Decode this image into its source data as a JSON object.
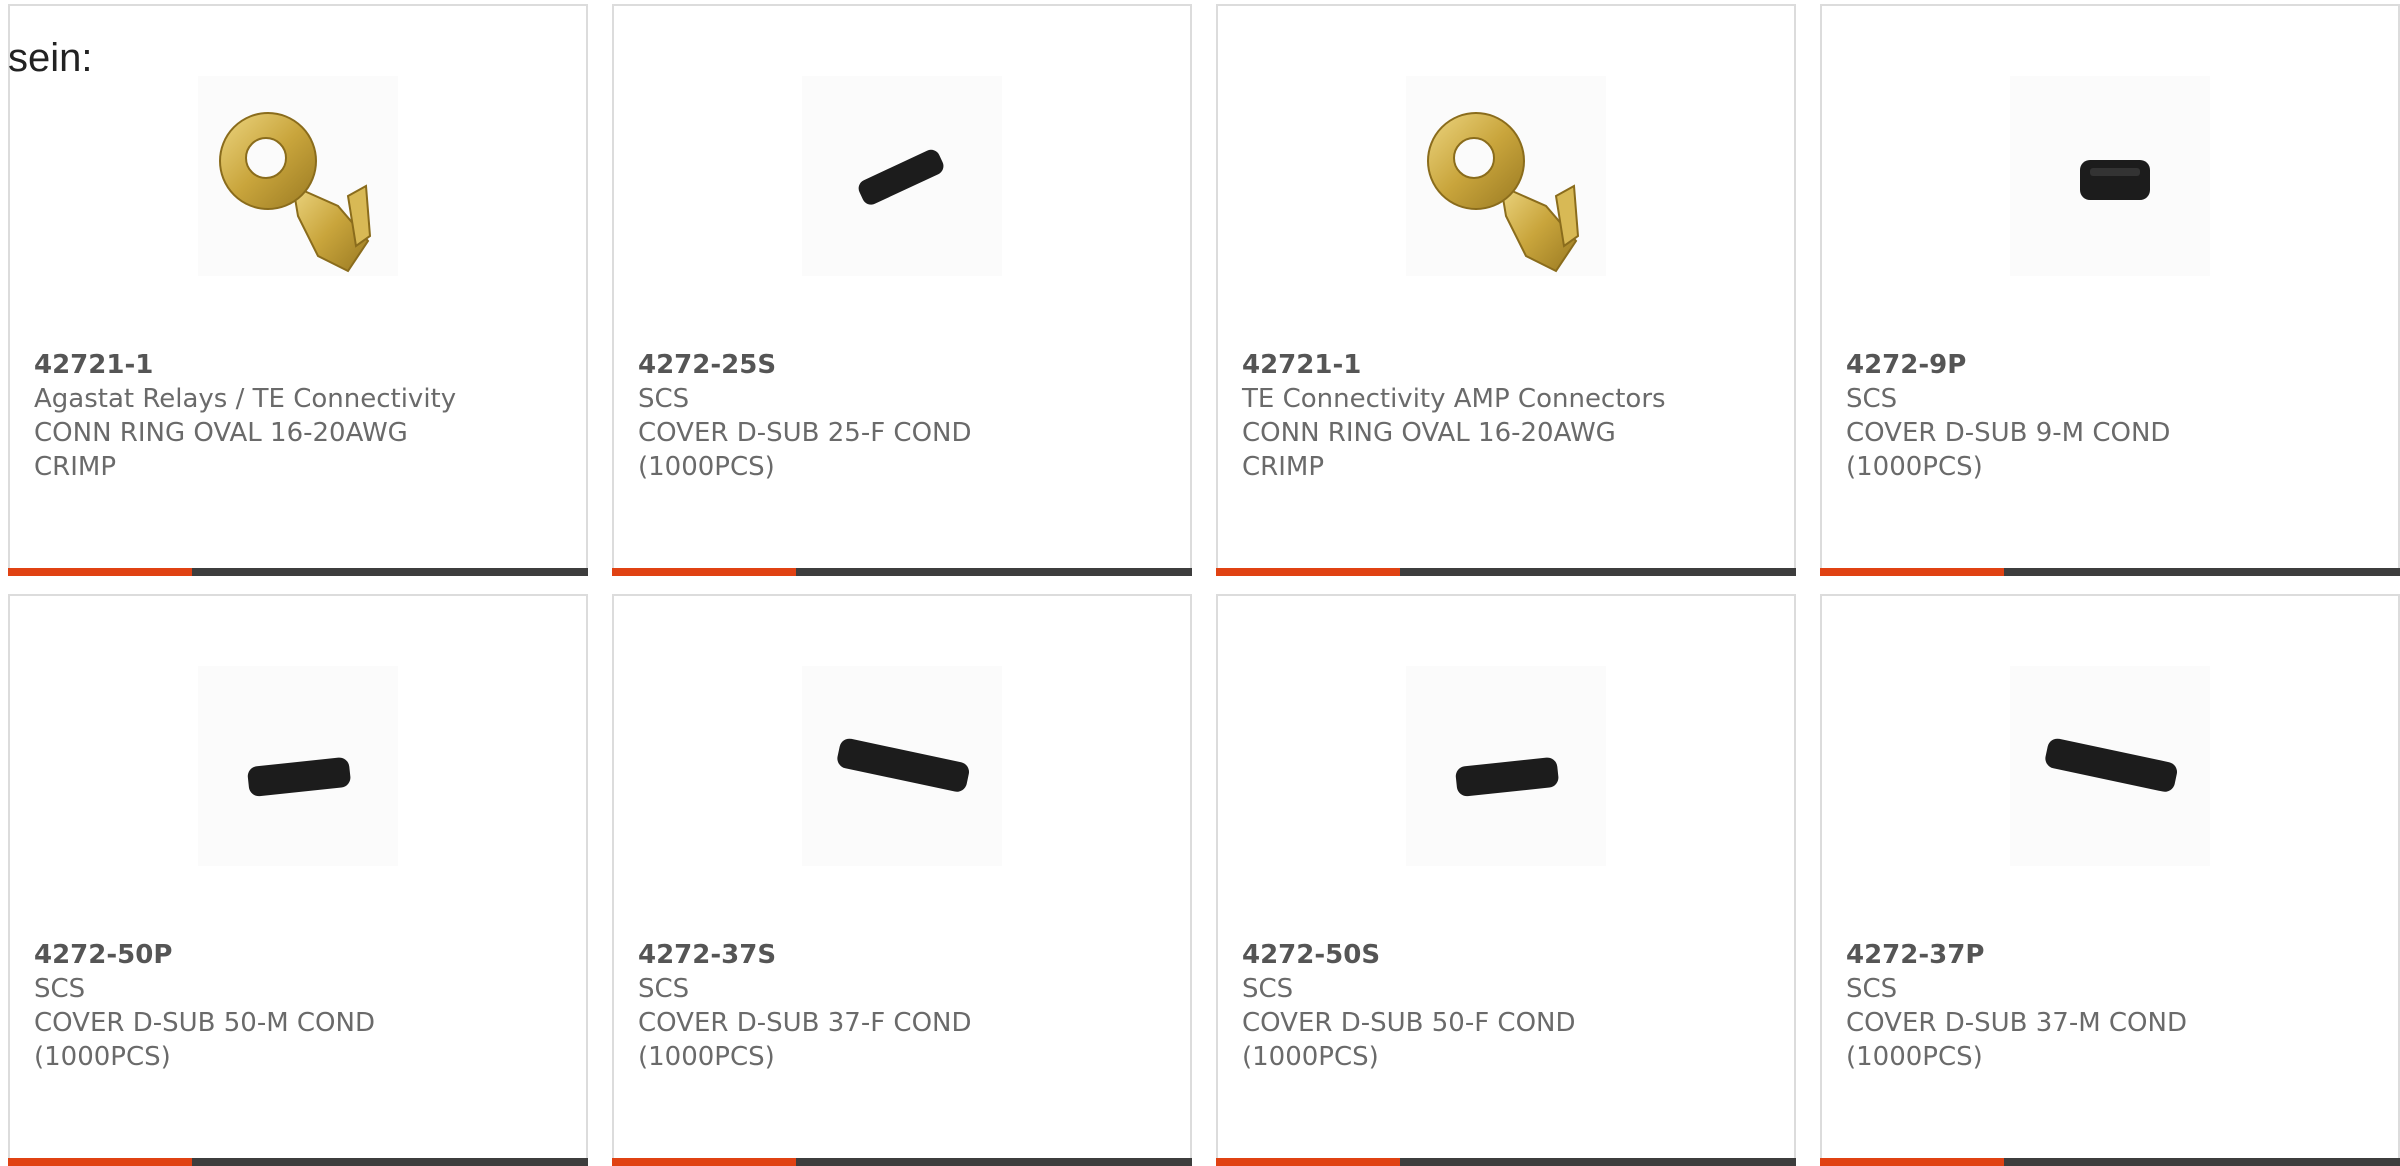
{
  "intro_text": "sein:",
  "colors": {
    "accent": "#e04213",
    "bar": "#3d3d3d",
    "border": "#dcdcdc",
    "text": "#6a6a6a"
  },
  "products": [
    {
      "part_number": "42721-1",
      "manufacturer": "Agastat Relays / TE Connectivity",
      "description": "CONN RING OVAL 16-20AWG CRIMP",
      "image_icon": "ring-terminal-icon"
    },
    {
      "part_number": "4272-25S",
      "manufacturer": "SCS",
      "description": "COVER D-SUB 25-F COND (1000PCS)",
      "image_icon": "dsub-cover-icon"
    },
    {
      "part_number": "42721-1",
      "manufacturer": "TE Connectivity AMP Connectors",
      "description": "CONN RING OVAL 16-20AWG CRIMP",
      "image_icon": "ring-terminal-icon"
    },
    {
      "part_number": "4272-9P",
      "manufacturer": "SCS",
      "description": "COVER D-SUB 9-M COND (1000PCS)",
      "image_icon": "dsub-cover-icon"
    },
    {
      "part_number": "4272-50P",
      "manufacturer": "SCS",
      "description": "COVER D-SUB 50-M COND (1000PCS)",
      "image_icon": "dsub-cover-icon"
    },
    {
      "part_number": "4272-37S",
      "manufacturer": "SCS",
      "description": "COVER D-SUB 37-F COND (1000PCS)",
      "image_icon": "dsub-cover-icon"
    },
    {
      "part_number": "4272-50S",
      "manufacturer": "SCS",
      "description": "COVER D-SUB 50-F COND (1000PCS)",
      "image_icon": "dsub-cover-icon"
    },
    {
      "part_number": "4272-37P",
      "manufacturer": "SCS",
      "description": "COVER D-SUB 37-M COND (1000PCS)",
      "image_icon": "dsub-cover-icon"
    }
  ]
}
